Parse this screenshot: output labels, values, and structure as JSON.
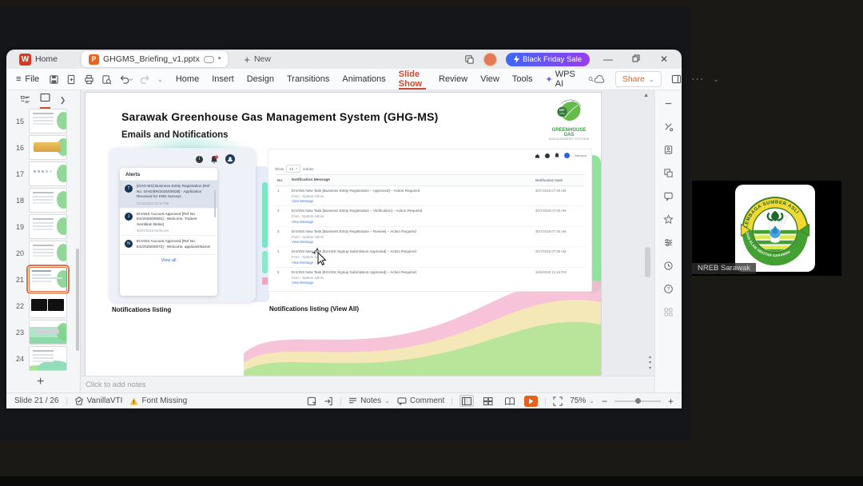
{
  "win": {
    "tabs": {
      "home": "Home",
      "doc": "GHGMS_Briefing_v1.pptx",
      "new_label": "New"
    },
    "promo": "Black Friday Sale",
    "file": "File",
    "menu": [
      "Home",
      "Insert",
      "Design",
      "Transitions",
      "Animations",
      "Slide Show",
      "Review",
      "View",
      "Tools",
      "WPS AI"
    ],
    "share": "Share"
  },
  "sidebar": {
    "slides": [
      {
        "num": "15",
        "variant": "lines",
        "selected": "false"
      },
      {
        "num": "16",
        "variant": "gold",
        "selected": "false"
      },
      {
        "num": "17",
        "variant": "dots",
        "selected": "false"
      },
      {
        "num": "18",
        "variant": "lines",
        "selected": "false"
      },
      {
        "num": "19",
        "variant": "lines",
        "selected": "false"
      },
      {
        "num": "20",
        "variant": "lines",
        "selected": "false"
      },
      {
        "num": "21",
        "variant": "current",
        "selected": "true"
      },
      {
        "num": "22",
        "variant": "dark",
        "selected": "false"
      },
      {
        "num": "23",
        "variant": "teal",
        "selected": "false"
      },
      {
        "num": "24",
        "variant": "tealblob",
        "selected": "false"
      }
    ]
  },
  "slide": {
    "title": "Sarawak Greenhouse Gas Management System (GHG-MS)",
    "subtitle": "Emails and Notifications",
    "logo": {
      "l1": "GREENHOUSE GAS",
      "l2": "MANAGEMENT SYSTEM",
      "badge1": "NET",
      "badge2": "2050"
    },
    "alerts": {
      "header": "Alerts",
      "view_all": "View all",
      "items": [
        {
          "initial": "T",
          "msg": "[GHG-MS] Business Entity Registration [Ref No. GHG/BR/2025/00028] - Application Received for KNN Surveys",
          "date": "21/10/2025 02:19 PM"
        },
        {
          "initial": "J",
          "msg": "EnVISS Account Approved [Ref No. ES/2025/00081] - Welcome, Trainee Sembilan Belas]",
          "date": "30/07/2025 09:09 AM"
        },
        {
          "initial": "N",
          "msg": "EnVISS Account Approved [Ref No. ES/2025/00072] - Welcome, applicantName!",
          "date": ""
        }
      ]
    },
    "table": {
      "user": "Johnson",
      "show": "Show",
      "show_value": "10",
      "entries": "entries",
      "col_no": "No.",
      "col_msg": "Notification Message",
      "col_date": "Notification Date",
      "rows": [
        {
          "no": "1",
          "msg": "EnVISS New Task [Business Entity Registration – Approved] – Action Required",
          "from": "From : System Admin",
          "link": "View Message",
          "date": "30/7/2025 07:49 AM"
        },
        {
          "no": "2",
          "msg": "EnVISS New Task [Business Entity Registration – Verification] – Action Required",
          "from": "From : System Admin",
          "link": "View Message",
          "date": "30/7/2025 07:49 AM"
        },
        {
          "no": "3",
          "msg": "EnVISS New Task [Business Entity Registration – Review] – Action Required",
          "from": "From : System Admin",
          "link": "View Message",
          "date": "30/7/2025 07:46 AM"
        },
        {
          "no": "4",
          "msg": "EnVISS New Task [EnVISS Signup Submission Approved] – Action Required",
          "from": "From : System Admin",
          "link": "View Message",
          "date": "30/7/2025 07:39 AM"
        },
        {
          "no": "5",
          "msg": "EnVISS New Task [EnVISS Signup Submission Approved] – Action Required",
          "from": "From : System Admin",
          "link": "View Message",
          "date": "16/6/2025 12:16 PM"
        }
      ]
    },
    "captions": {
      "left": "Notifications listing",
      "right": "Notifications listing (View All)"
    }
  },
  "status": {
    "slide": "Slide 21 / 26",
    "theme": "VanillaVTI",
    "font_missing": "Font Missing",
    "notes": "Notes",
    "comment": "Comment",
    "zoom": "75%"
  },
  "notes": {
    "placeholder": "Click to add notes"
  },
  "meeting": {
    "label": "NREB Sarawak",
    "logo_top": "LEMBAGA SUMBER ASLI",
    "logo_bottom": "DAN ALAM SEKITAR SARAWAK"
  }
}
